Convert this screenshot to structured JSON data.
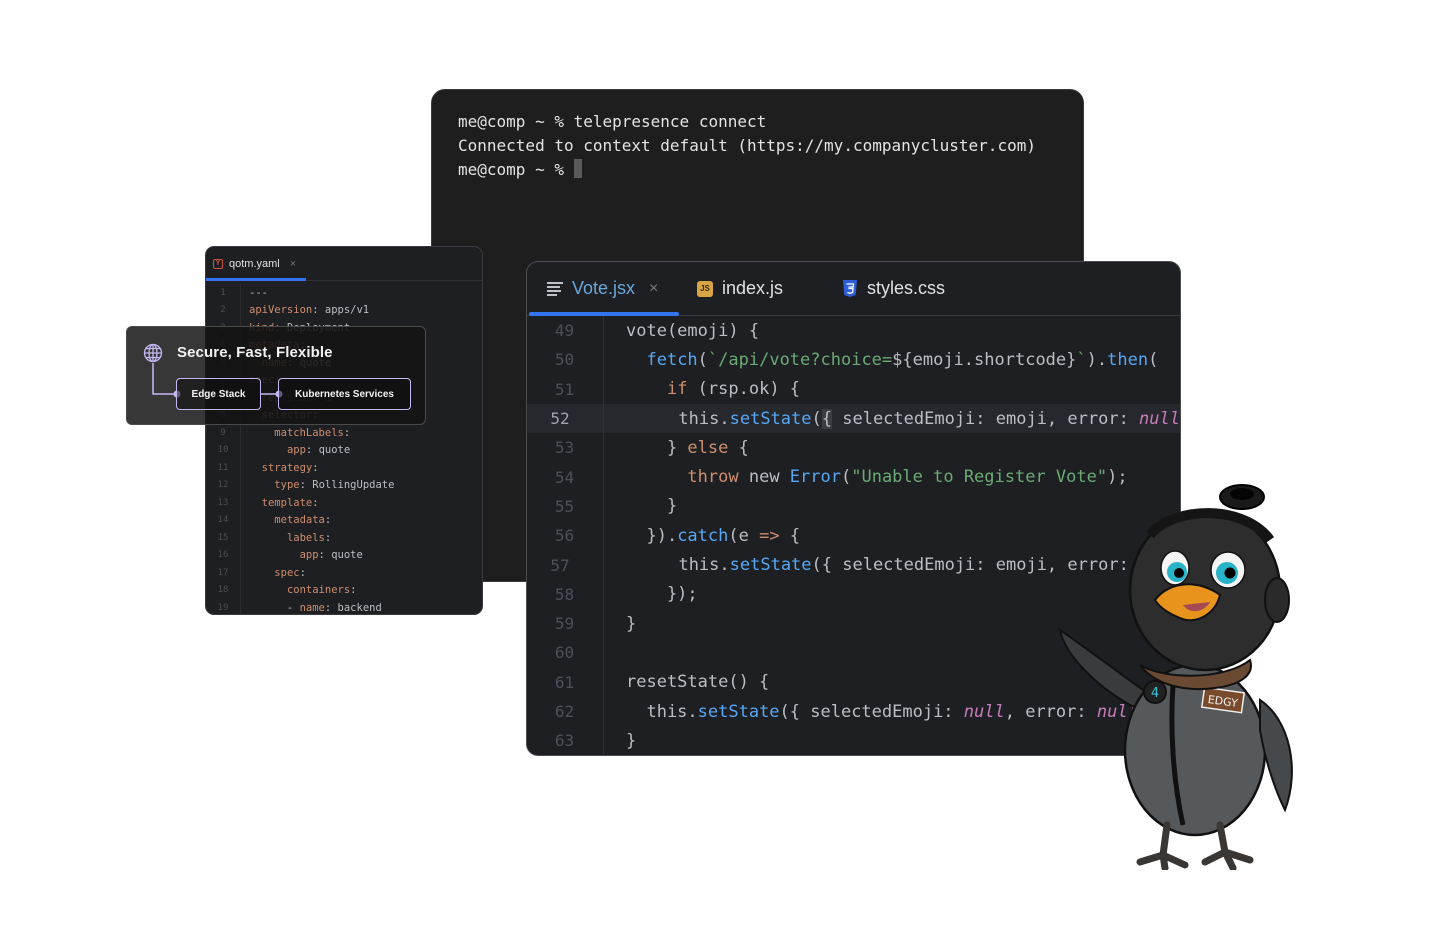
{
  "terminal": {
    "lines": [
      "me@comp ~ % telepresence connect",
      "Connected to context default (https://my.companycluster.com)",
      "me@comp ~ % "
    ]
  },
  "yaml_editor": {
    "tab": {
      "label": "qotm.yaml",
      "icon": "yaml-file-icon",
      "close": "×"
    },
    "lines": [
      {
        "n": "1",
        "indent": "",
        "key": "",
        "sep": "",
        "val": "---"
      },
      {
        "n": "2",
        "indent": "",
        "key": "apiVersion",
        "sep": ": ",
        "val": "apps/v1"
      },
      {
        "n": "3",
        "indent": "",
        "key": "kind",
        "sep": ": ",
        "val": "Deployment"
      },
      {
        "n": "4",
        "indent": "",
        "key": "metadata",
        "sep": ":",
        "val": ""
      },
      {
        "n": "5",
        "indent": "  ",
        "key": "name",
        "sep": ": ",
        "val": "quote"
      },
      {
        "n": "6",
        "indent": "",
        "key": "spec",
        "sep": ":",
        "val": ""
      },
      {
        "n": "7",
        "indent": "  ",
        "key": "replicas",
        "sep": ": ",
        "val": "1"
      },
      {
        "n": "8",
        "indent": "  ",
        "key": "selector",
        "sep": ":",
        "val": ""
      },
      {
        "n": "9",
        "indent": "    ",
        "key": "matchLabels",
        "sep": ":",
        "val": ""
      },
      {
        "n": "10",
        "indent": "      ",
        "key": "app",
        "sep": ": ",
        "val": "quote"
      },
      {
        "n": "11",
        "indent": "  ",
        "key": "strategy",
        "sep": ":",
        "val": ""
      },
      {
        "n": "12",
        "indent": "    ",
        "key": "type",
        "sep": ": ",
        "val": "RollingUpdate"
      },
      {
        "n": "13",
        "indent": "  ",
        "key": "template",
        "sep": ":",
        "val": ""
      },
      {
        "n": "14",
        "indent": "    ",
        "key": "metadata",
        "sep": ":",
        "val": ""
      },
      {
        "n": "15",
        "indent": "      ",
        "key": "labels",
        "sep": ":",
        "val": ""
      },
      {
        "n": "16",
        "indent": "        ",
        "key": "app",
        "sep": ": ",
        "val": "quote"
      },
      {
        "n": "17",
        "indent": "    ",
        "key": "spec",
        "sep": ":",
        "val": ""
      },
      {
        "n": "18",
        "indent": "      ",
        "key": "containers",
        "sep": ":",
        "val": ""
      },
      {
        "n": "19",
        "indent": "      - ",
        "key": "name",
        "sep": ": ",
        "val": "backend"
      }
    ]
  },
  "feature_card": {
    "title": "Secure, Fast, Flexible",
    "icon": "globe-icon",
    "nodes": [
      "Edge Stack",
      "Kubernetes Services"
    ]
  },
  "code_editor": {
    "tabs": [
      {
        "label": "Vote.jsx",
        "icon": "lines-icon",
        "active": true,
        "close": "×"
      },
      {
        "label": "index.js",
        "icon": "js-file-icon",
        "icon_text": "JS"
      },
      {
        "label": "styles.css",
        "icon": "css-file-icon"
      }
    ],
    "current_line": "52",
    "lines": [
      {
        "n": "49",
        "tokens": [
          [
            "",
            "vote(emoji) {"
          ]
        ]
      },
      {
        "n": "50",
        "tokens": [
          [
            "",
            "  "
          ],
          [
            "fn",
            "fetch"
          ],
          [
            "",
            "("
          ],
          [
            "str",
            "`/api/vote?choice="
          ],
          [
            "",
            "${emoji.shortcode}"
          ],
          [
            "str",
            "`"
          ],
          [
            "",
            ")."
          ],
          [
            "fn",
            "then"
          ],
          [
            "",
            "("
          ]
        ]
      },
      {
        "n": "51",
        "tokens": [
          [
            "",
            "    "
          ],
          [
            "kw",
            "if"
          ],
          [
            "",
            " (rsp.ok) {"
          ]
        ]
      },
      {
        "n": "52",
        "tokens": [
          [
            "",
            "      this."
          ],
          [
            "fn",
            "setState"
          ],
          [
            "",
            "("
          ],
          [
            "caret",
            "{"
          ],
          [
            "",
            " selectedEmoji: emoji, error: "
          ],
          [
            "nul",
            "null"
          ]
        ]
      },
      {
        "n": "53",
        "tokens": [
          [
            "",
            "    } "
          ],
          [
            "kw",
            "else"
          ],
          [
            "",
            " {"
          ]
        ]
      },
      {
        "n": "54",
        "tokens": [
          [
            "",
            "      "
          ],
          [
            "kw",
            "throw"
          ],
          [
            "",
            " new "
          ],
          [
            "fn",
            "Error"
          ],
          [
            "",
            "("
          ],
          [
            "str",
            "\"Unable to Register Vote\""
          ],
          [
            "",
            ");"
          ]
        ]
      },
      {
        "n": "55",
        "tokens": [
          [
            "",
            "    }"
          ]
        ]
      },
      {
        "n": "56",
        "tokens": [
          [
            "",
            "  })."
          ],
          [
            "fn",
            "catch"
          ],
          [
            "",
            "(e "
          ],
          [
            "kw",
            "=>"
          ],
          [
            "",
            " {"
          ]
        ]
      },
      {
        "n": "57",
        "tokens": [
          [
            "",
            "      this."
          ],
          [
            "fn",
            "setState"
          ],
          [
            "",
            "({ selectedEmoji: emoji, error: e })"
          ]
        ]
      },
      {
        "n": "58",
        "tokens": [
          [
            "",
            "    });"
          ]
        ]
      },
      {
        "n": "59",
        "tokens": [
          [
            "",
            "}"
          ]
        ]
      },
      {
        "n": "60",
        "tokens": [
          [
            "",
            ""
          ]
        ]
      },
      {
        "n": "61",
        "tokens": [
          [
            "",
            "resetState() {"
          ]
        ]
      },
      {
        "n": "62",
        "tokens": [
          [
            "",
            "  this."
          ],
          [
            "fn",
            "setState"
          ],
          [
            "",
            "({ selectedEmoji: "
          ],
          [
            "nul",
            "null"
          ],
          [
            "",
            ", error: "
          ],
          [
            "nul",
            "null"
          ],
          [
            "",
            " })"
          ]
        ]
      },
      {
        "n": "63",
        "tokens": [
          [
            "",
            "}"
          ]
        ]
      }
    ]
  },
  "mascot": {
    "badge_text": "EDGY",
    "patch_text": "4"
  },
  "colors": {
    "accent_blue": "#3574f0",
    "keyword": "#cf8e6d",
    "function": "#56a8f5",
    "string": "#6aab73",
    "null": "#c77dbb",
    "node_border": "#c7b7f2"
  }
}
